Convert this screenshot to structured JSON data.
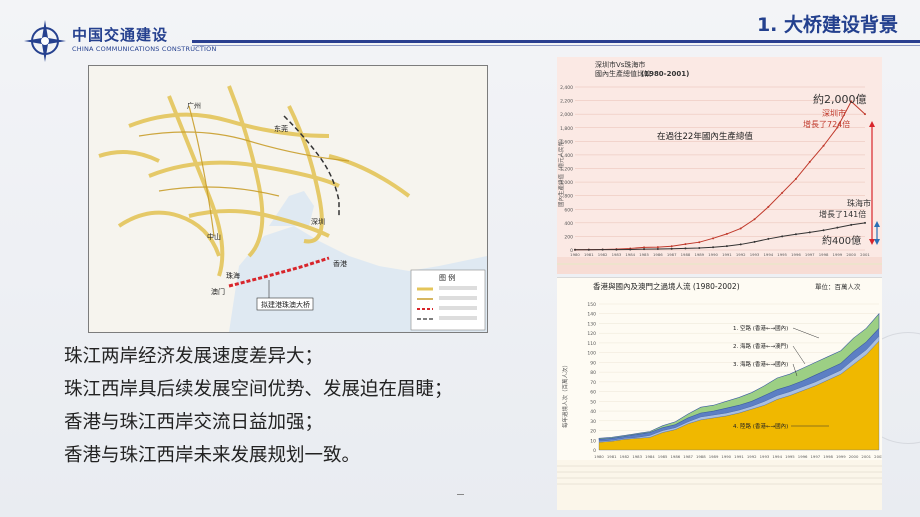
{
  "header": {
    "logo_cn": "中国交通建设",
    "logo_en": "CHINA COMMUNICATIONS CONSTRUCTION",
    "title": "1. 大桥建设背景"
  },
  "map": {
    "labels": [
      "广州",
      "东莞",
      "中山",
      "深圳",
      "珠海",
      "香港",
      "澳门"
    ],
    "bridge_label": "拟建港珠澳大桥",
    "legend_title": "图 例",
    "colors": {
      "bridge": "#d8252b",
      "highway": "#e4c55a",
      "rail": "#333333",
      "sea": "#dfe9f2"
    }
  },
  "gdp_chart": {
    "title_line1": "深圳市Vs珠海市",
    "title_line2": "國內生產總值比較",
    "title_range": "(1980-2001)",
    "annotation_center": "在過往22年國內生產總值",
    "annotation_top": "約2,000億",
    "shenzhen_label": "深圳市",
    "shenzhen_growth": "增長了724倍",
    "zhuhai_label": "珠海市",
    "zhuhai_growth": "增長了141倍",
    "annotation_bottom": "約400億",
    "y_axis_label": "國內生產總值（億元人民幣）",
    "colors": {
      "shenzhen": "#c0392b",
      "zhuhai": "#333333",
      "arrow_red": "#d8252b",
      "arrow_blue": "#2a6fb5"
    }
  },
  "pax_chart": {
    "title": "香港與國內及澳門之過境人流 (1980-2002)",
    "unit": "單位：百萬人次",
    "y_axis_label": "每年過境人次（百萬人次）",
    "series_labels": [
      "1. 空路 (香港←→國內)",
      "2. 海路 (香港←→澳門)",
      "3. 海路 (香港←→國內)",
      "4. 陸路 (香港←→國內)"
    ],
    "colors": {
      "land": "#f0b800",
      "sea_mainland": "#a9bfe0",
      "sea_macau": "#5c7fc4",
      "air": "#9ccf84"
    }
  },
  "chart_data": [
    {
      "type": "line",
      "title": "深圳市Vs珠海市 國內生產總值比較 (1980-2001)",
      "x": [
        1980,
        1981,
        1982,
        1983,
        1984,
        1985,
        1986,
        1987,
        1988,
        1989,
        1990,
        1991,
        1992,
        1993,
        1994,
        1995,
        1996,
        1997,
        1998,
        1999,
        2000,
        2001
      ],
      "series": [
        {
          "name": "深圳市",
          "values": [
            3,
            5,
            8,
            13,
            23,
            39,
            42,
            56,
            87,
            115,
            172,
            237,
            317,
            453,
            635,
            842,
            1048,
            1297,
            1535,
            1804,
            2187,
            2000
          ]
        },
        {
          "name": "珠海市",
          "values": [
            3,
            4,
            5,
            6,
            8,
            12,
            14,
            18,
            24,
            30,
            41,
            57,
            82,
            120,
            163,
            201,
            232,
            260,
            290,
            330,
            370,
            400
          ]
        }
      ],
      "ylim": [
        0,
        2400
      ],
      "ylabel": "國內生產總值（億元人民幣）"
    },
    {
      "type": "area",
      "title": "香港與國內及澳門之過境人流 (1980-2002)",
      "x": [
        1980,
        1981,
        1982,
        1983,
        1984,
        1985,
        1986,
        1987,
        1988,
        1989,
        1990,
        1991,
        1992,
        1993,
        1994,
        1995,
        1996,
        1997,
        1998,
        1999,
        2000,
        2001,
        2002
      ],
      "series": [
        {
          "name": "4. 陸路 (香港←→國內)",
          "values": [
            8,
            9,
            11,
            12,
            13,
            18,
            21,
            27,
            31,
            33,
            35,
            38,
            42,
            46,
            52,
            56,
            61,
            66,
            72,
            78,
            88,
            98,
            112
          ]
        },
        {
          "name": "3. 海路 (香港←→國內)",
          "values": [
            1,
            1,
            1,
            1,
            2,
            2,
            2,
            2,
            3,
            3,
            3,
            3,
            3,
            4,
            4,
            4,
            4,
            4,
            4,
            4,
            5,
            5,
            5
          ]
        },
        {
          "name": "2. 海路 (香港←→澳門)",
          "values": [
            2,
            2,
            2,
            3,
            3,
            3,
            3,
            4,
            4,
            4,
            5,
            5,
            5,
            6,
            6,
            6,
            6,
            7,
            7,
            7,
            8,
            8,
            8
          ]
        },
        {
          "name": "1. 空路 (香港←→國內)",
          "values": [
            1,
            1,
            1,
            1,
            1,
            2,
            3,
            4,
            6,
            6,
            7,
            8,
            9,
            10,
            12,
            12,
            13,
            13,
            13,
            13,
            14,
            14,
            15
          ]
        }
      ],
      "ylim": [
        0,
        150
      ],
      "ylabel": "每年過境人次（百萬人次）"
    }
  ],
  "bullets": [
    "珠江两岸经济发展速度差异大；",
    "珠江西岸具后续发展空间优势、发展迫在眉睫；",
    "香港与珠江西岸交流日益加强；",
    "香港与珠江西岸未来发展规划一致。"
  ]
}
